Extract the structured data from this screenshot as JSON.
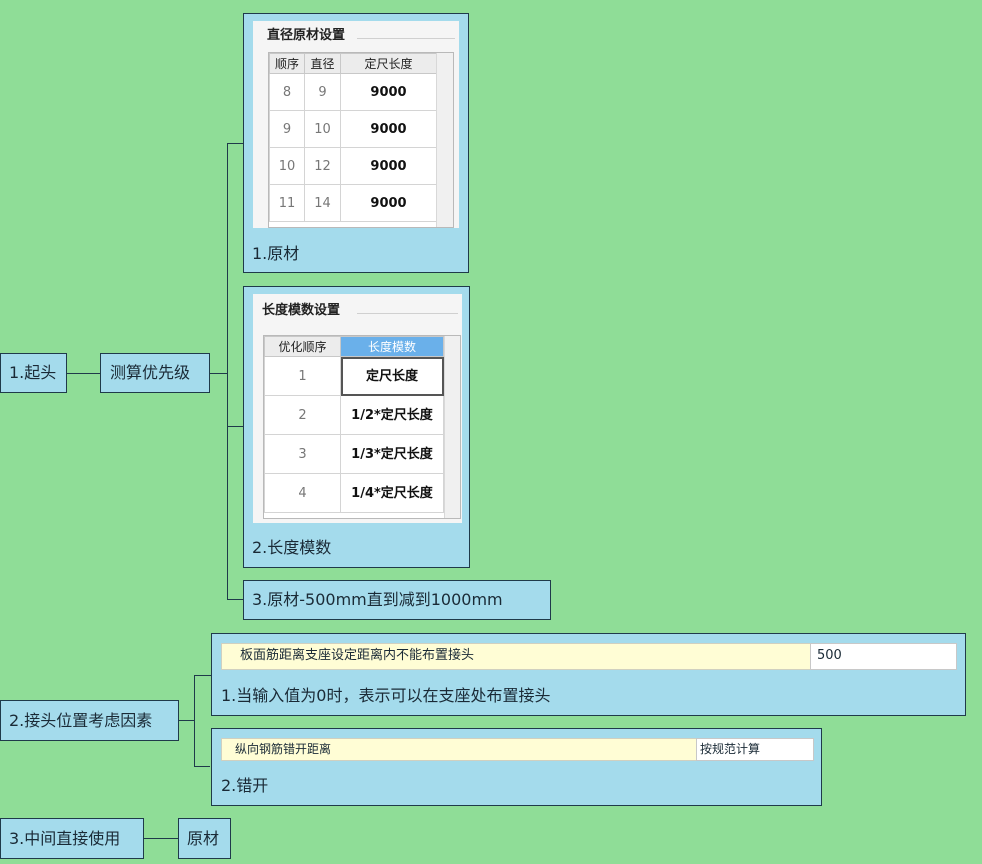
{
  "nodes": {
    "root1": "1.起头",
    "priority": "测算优先级",
    "raw": "1.原材",
    "modulus": "2.长度模数",
    "reduce": "3.原材-500mm直到减到1000mm",
    "root2": "2.接头位置考虑因素",
    "support_note": "1.当输入值为0时，表示可以在支座处布置接头",
    "stagger": "2.错开",
    "root3": "3.中间直接使用",
    "raw2": "原材"
  },
  "diameter_panel": {
    "title": "直径原材设置",
    "columns": [
      "顺序",
      "直径",
      "定尺长度"
    ],
    "rows": [
      [
        "8",
        "9",
        "9000"
      ],
      [
        "9",
        "10",
        "9000"
      ],
      [
        "10",
        "12",
        "9000"
      ],
      [
        "11",
        "14",
        "9000"
      ]
    ]
  },
  "modulus_panel": {
    "title": "长度模数设置",
    "columns": [
      "优化顺序",
      "长度模数"
    ],
    "rows": [
      [
        "1",
        "定尺长度"
      ],
      [
        "2",
        "1/2*定尺长度"
      ],
      [
        "3",
        "1/3*定尺长度"
      ],
      [
        "4",
        "1/4*定尺长度"
      ]
    ]
  },
  "support_form": {
    "label": "板面筋距离支座设定距离内不能布置接头",
    "value": "500"
  },
  "stagger_form": {
    "label": "纵向钢筋错开距离",
    "value": "按规范计算"
  },
  "colors": {
    "background": "#8fdd97",
    "node_fill": "#a4dbec",
    "node_border": "#1f3a4a",
    "header_selected": "#6ab0ea",
    "form_label_fill": "#fffdd5"
  }
}
